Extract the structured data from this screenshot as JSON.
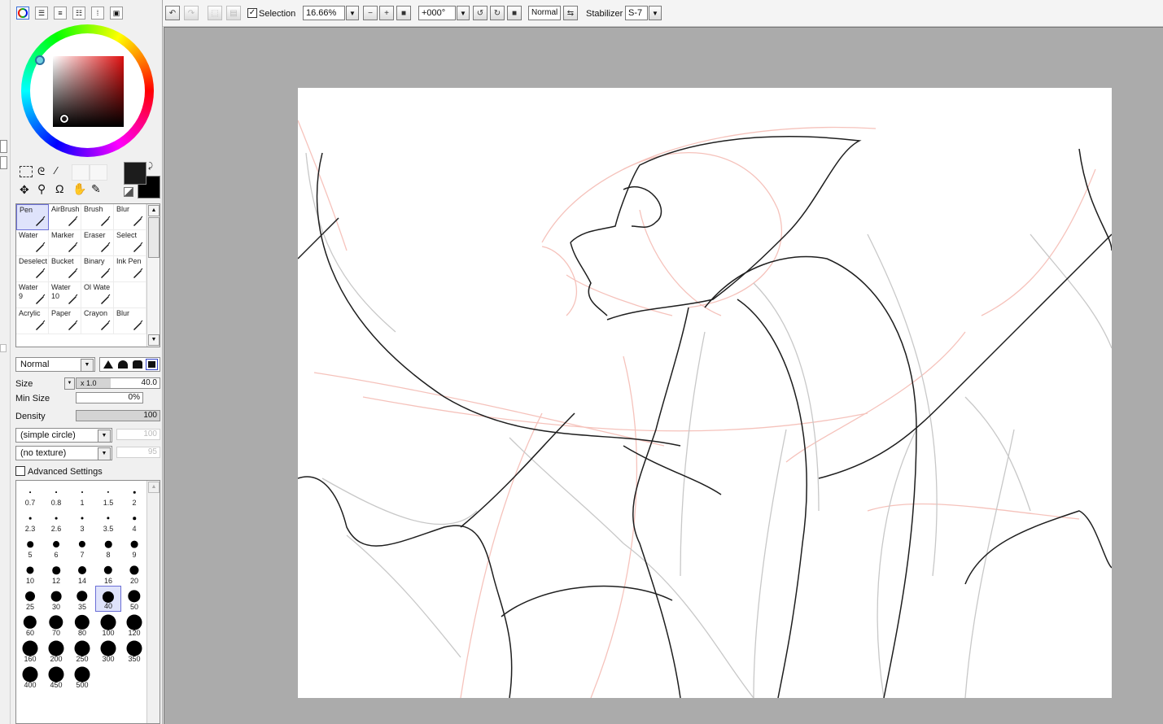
{
  "toolbar": {
    "selection_label": "Selection",
    "selection_checked": true,
    "zoom": "16.66%",
    "rotation": "+000°",
    "blend_mode": "Normal",
    "stabilizer_label": "Stabilizer",
    "stabilizer_value": "S-7"
  },
  "color": {
    "primary": "#1c1c1c",
    "secondary": "#000000",
    "picked": "#000000"
  },
  "tools": [
    {
      "label": "Pen"
    },
    {
      "label": "AirBrush"
    },
    {
      "label": "Brush"
    },
    {
      "label": "Blur"
    },
    {
      "label": "Water"
    },
    {
      "label": "Marker"
    },
    {
      "label": "Eraser"
    },
    {
      "label": "Select"
    },
    {
      "label": "Deselect"
    },
    {
      "label": "Bucket"
    },
    {
      "label": "Binary"
    },
    {
      "label": "Ink Pen"
    },
    {
      "label": "Water\n9"
    },
    {
      "label": "Water\n10"
    },
    {
      "label": "Ol Wate"
    },
    {
      "label": ""
    },
    {
      "label": "Acrylic"
    },
    {
      "label": "Paper"
    },
    {
      "label": "Crayon"
    },
    {
      "label": "Blur"
    }
  ],
  "brush": {
    "mode": "Normal",
    "size_label": "Size",
    "size_multiplier": "x 1.0",
    "size_value": "40.0",
    "min_size_label": "Min Size",
    "min_size_value": "0%",
    "density_label": "Density",
    "density_value": "100",
    "shape": "(simple circle)",
    "shape_value": "100",
    "texture": "(no texture)",
    "texture_value": "95",
    "advanced_label": "Advanced Settings"
  },
  "sizes": [
    "0.7",
    "0.8",
    "1",
    "1.5",
    "2",
    "2.3",
    "2.6",
    "3",
    "3.5",
    "4",
    "5",
    "6",
    "7",
    "8",
    "9",
    "10",
    "12",
    "14",
    "16",
    "20",
    "25",
    "30",
    "35",
    "40",
    "50",
    "60",
    "70",
    "80",
    "100",
    "120",
    "160",
    "200",
    "250",
    "300",
    "350",
    "400",
    "450",
    "500"
  ],
  "selected_size": "40"
}
